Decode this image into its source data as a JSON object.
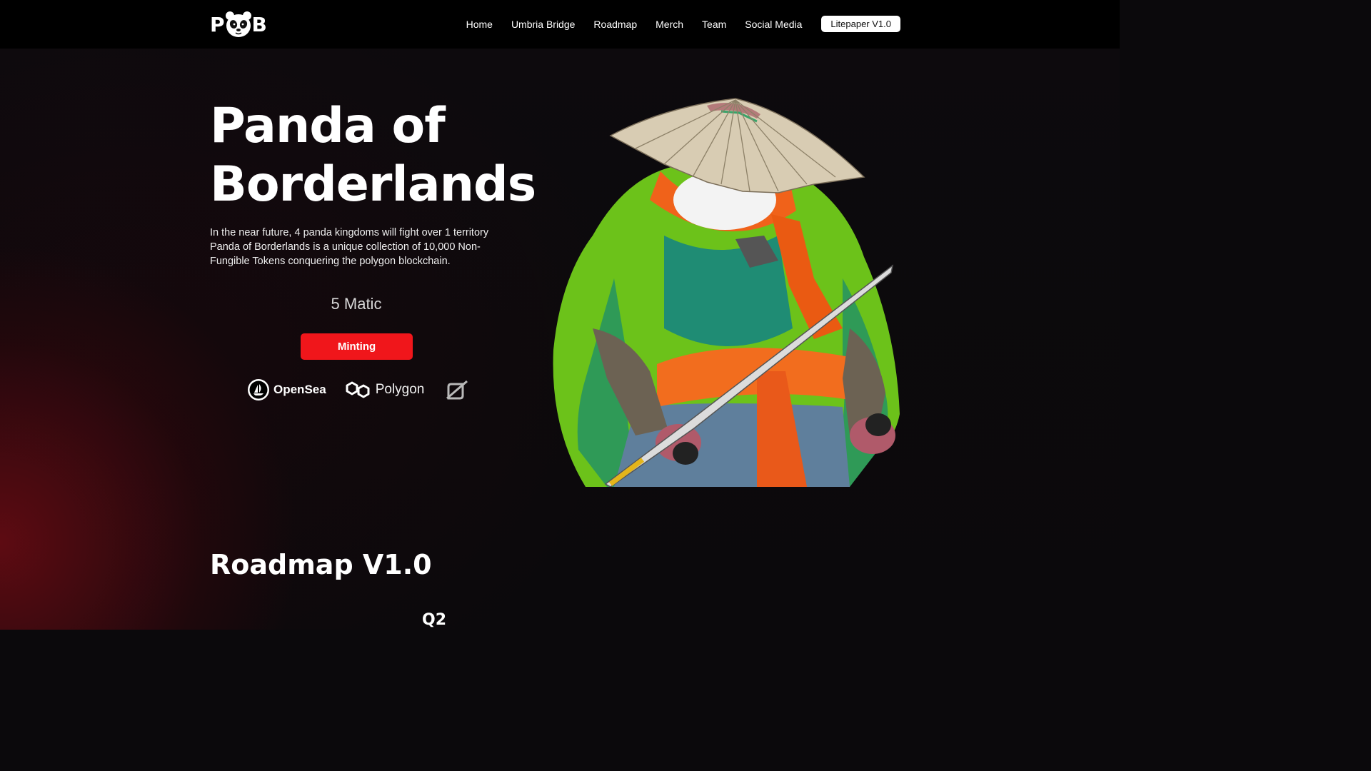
{
  "nav": {
    "logo_left": "P",
    "logo_right": "B",
    "links": [
      "Home",
      "Umbria Bridge",
      "Roadmap",
      "Merch",
      "Team",
      "Social Media"
    ],
    "cta": "Litepaper V1.0"
  },
  "hero": {
    "title_line1": "Panda of",
    "title_line2": "Borderlands",
    "description": "In the near future, 4 panda kingdoms will fight over 1 territory Panda of Borderlands is a unique collection of 10,000 Non-Fungible Tokens conquering the polygon blockchain.",
    "price": "5 Matic",
    "mint_label": "Minting"
  },
  "partners": {
    "opensea": "OpenSea",
    "polygon": "Polygon"
  },
  "roadmap": {
    "title": "Roadmap V1.0",
    "first_quarter": "Q2"
  },
  "colors": {
    "accent": "#f0161b",
    "background": "#0b090c",
    "navbar": "#000000"
  }
}
